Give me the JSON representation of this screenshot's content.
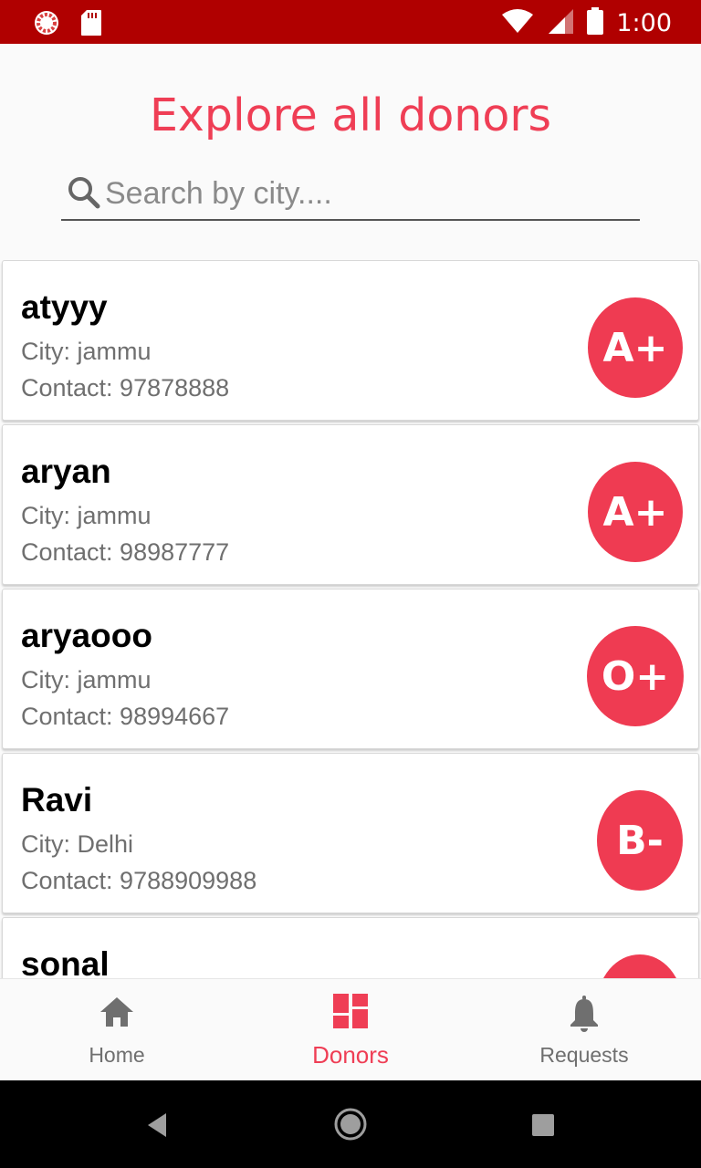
{
  "statusbar": {
    "time": "1:00"
  },
  "header": {
    "title": "Explore all donors"
  },
  "search": {
    "placeholder": "Search by city...."
  },
  "donors": [
    {
      "name": "atyyy",
      "city": "City: jammu",
      "contact": "Contact: 97878888",
      "blood_group": "A+"
    },
    {
      "name": "aryan",
      "city": "City: jammu",
      "contact": "Contact: 98987777",
      "blood_group": "A+"
    },
    {
      "name": "aryaooo",
      "city": "City: jammu",
      "contact": "Contact: 98994667",
      "blood_group": "O+"
    },
    {
      "name": "Ravi",
      "city": "City: Delhi",
      "contact": "Contact: 9788909988",
      "blood_group": "B-"
    },
    {
      "name": "sonal"
    }
  ],
  "bottom_nav": {
    "items": [
      {
        "label": "Home",
        "icon": "home-icon"
      },
      {
        "label": "Donors",
        "icon": "dashboard-icon",
        "active": true
      },
      {
        "label": "Requests",
        "icon": "bell-icon"
      }
    ]
  },
  "colors": {
    "accent": "#ef3e55",
    "statusbar": "#b00000",
    "badge": "#ef3b52"
  }
}
